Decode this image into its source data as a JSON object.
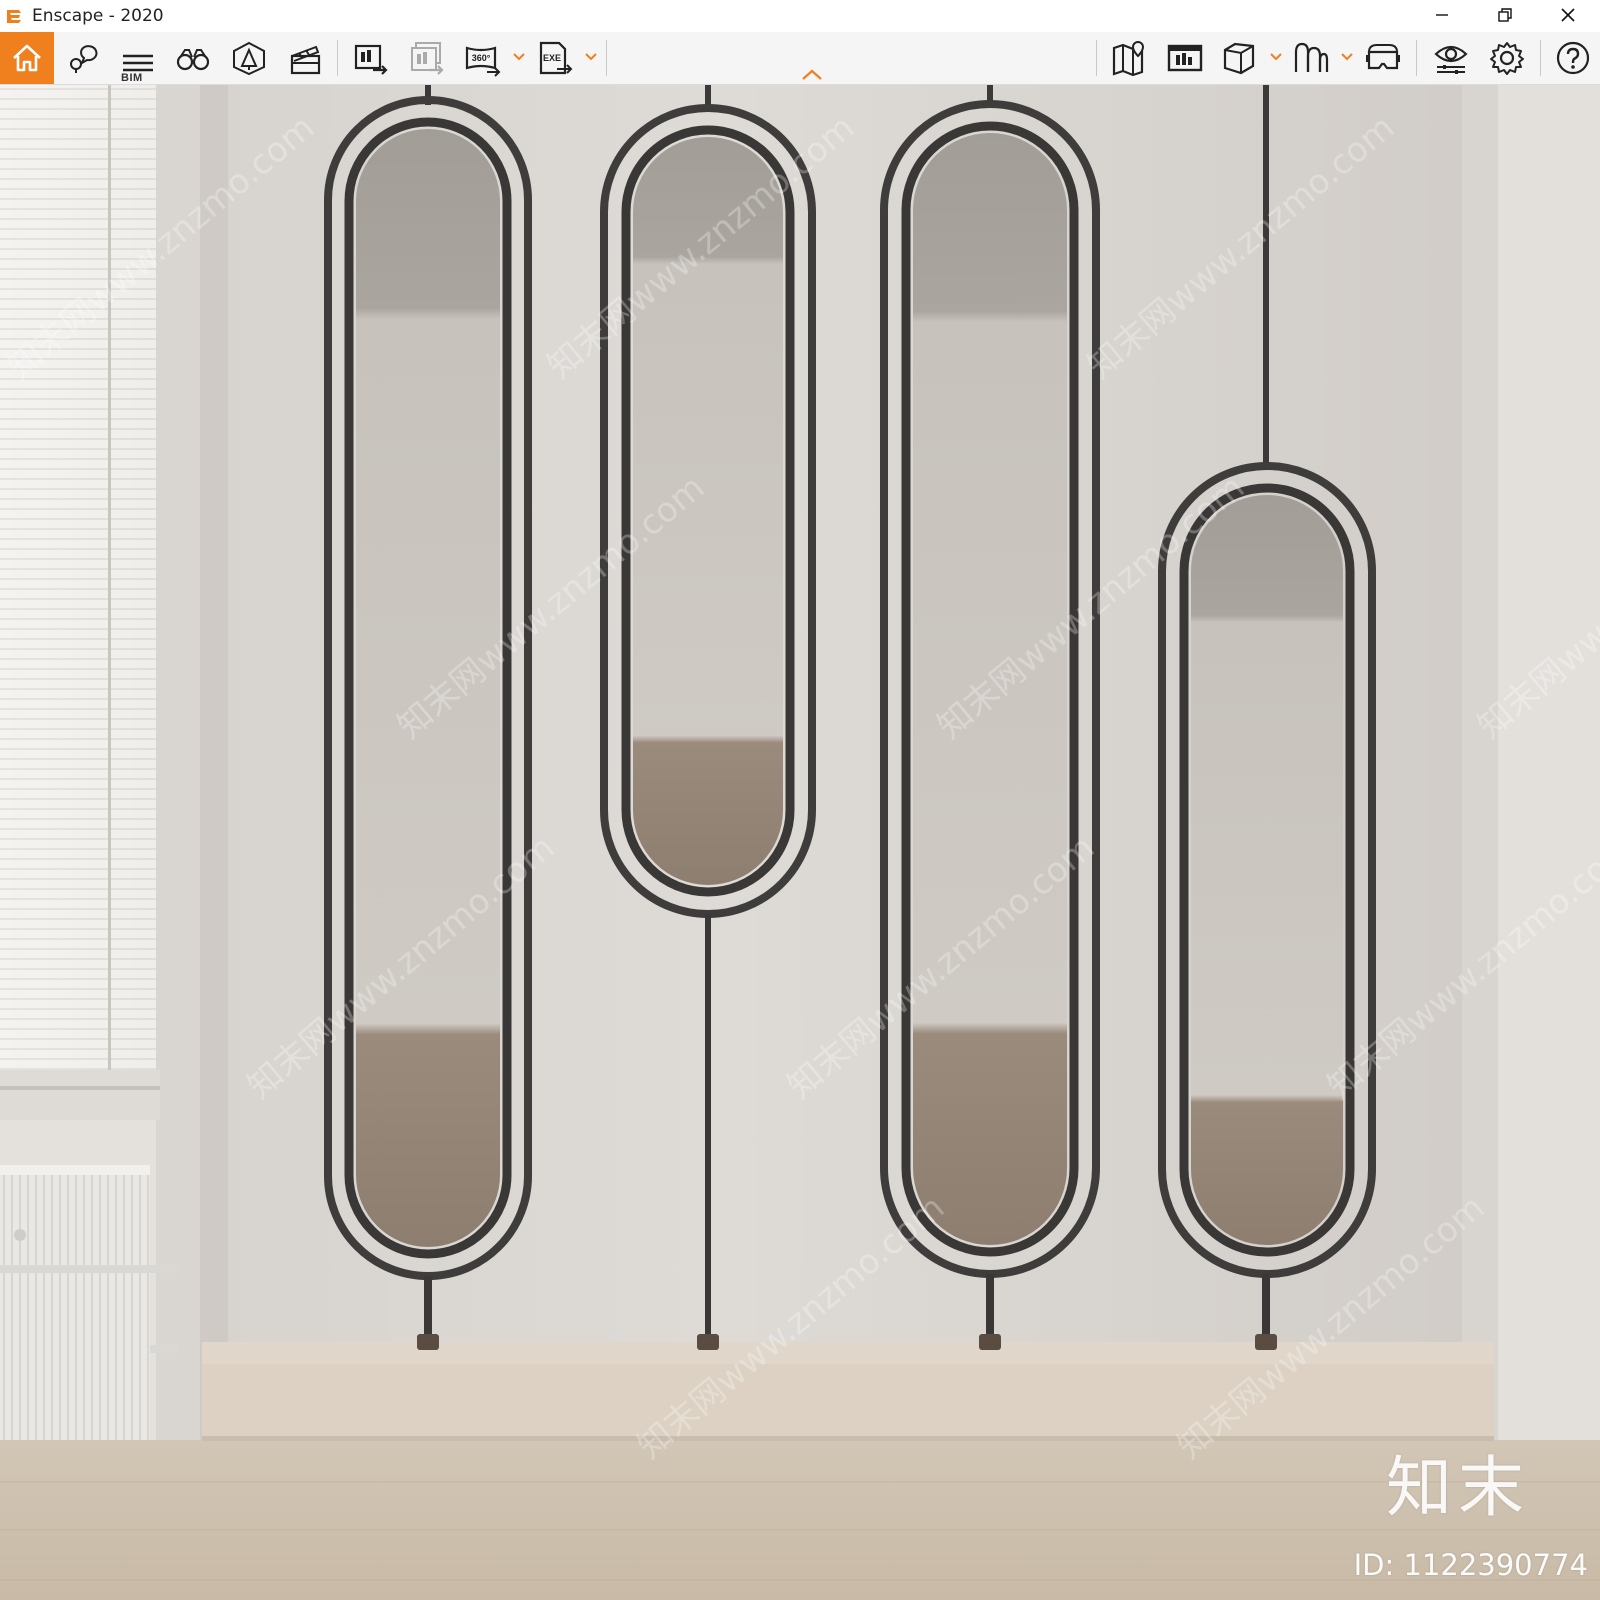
{
  "window": {
    "title": "Enscape - 2020"
  },
  "toolbar": {
    "bim_label": "BIM",
    "accent_color": "#f07f1e",
    "icons": [
      "home-icon",
      "asset-search-icon",
      "bim-list-icon",
      "binoculars-icon",
      "light-view-icon",
      "clapper-video-icon",
      "render-screenshot-icon",
      "batch-render-icon",
      "panorama-360-icon",
      "export-exe-icon",
      "map-icon",
      "screenshot-gallery-icon",
      "cube-view-icon",
      "site-context-icon",
      "vr-headset-icon",
      "visual-settings-icon",
      "settings-gear-icon",
      "help-icon"
    ]
  },
  "scene": {
    "description_icons": [
      "mirror-panel",
      "window-blinds",
      "radiator"
    ],
    "watermark_text": "知末网www.znzmo.com"
  },
  "footer": {
    "brand": "知末",
    "image_id": "ID: 1122390774"
  }
}
